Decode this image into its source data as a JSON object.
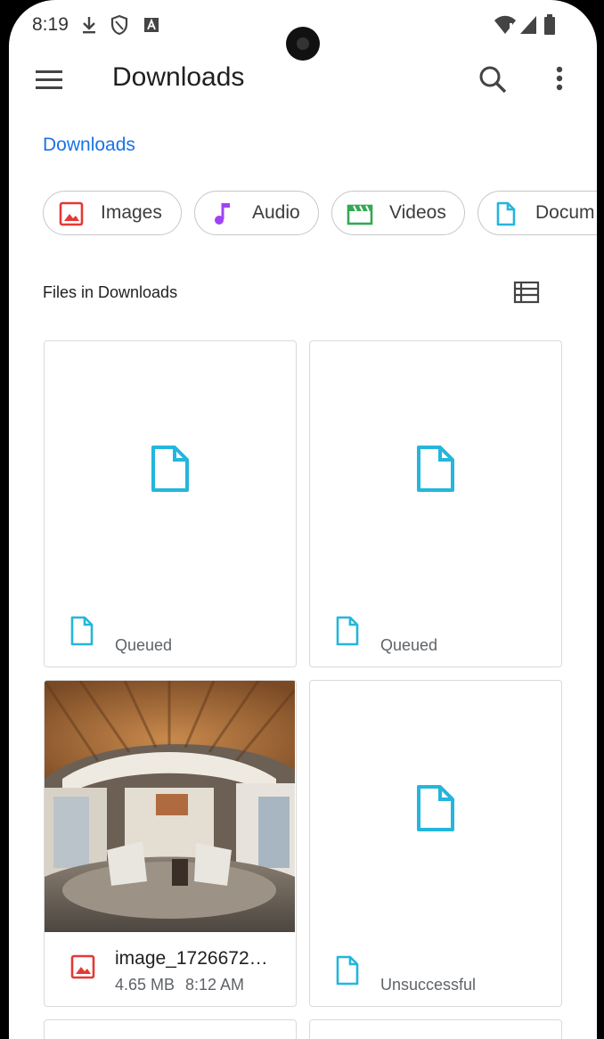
{
  "status_bar": {
    "time": "8:19",
    "icons": [
      "download-icon",
      "shield-icon",
      "keyboard-a-icon",
      "wifi-alert-icon",
      "signal-icon",
      "battery-icon"
    ]
  },
  "app_bar": {
    "title": "Downloads",
    "icons": [
      "menu-icon",
      "search-icon",
      "more-vert-icon"
    ]
  },
  "breadcrumb": {
    "current": "Downloads"
  },
  "filter_chips": [
    {
      "label": "Images",
      "icon": "image-icon",
      "color": "#e53935"
    },
    {
      "label": "Audio",
      "icon": "music-note-icon",
      "color": "#a142f4"
    },
    {
      "label": "Videos",
      "icon": "movie-icon",
      "color": "#34a853"
    },
    {
      "label": "Docum",
      "icon": "document-icon",
      "color": "#24b6dc"
    }
  ],
  "section": {
    "title": "Files in Downloads",
    "view_toggle_icon": "list-view-icon"
  },
  "files": [
    {
      "status": "Queued",
      "icon": "document-icon"
    },
    {
      "status": "Queued",
      "icon": "document-icon"
    },
    {
      "name": "image_1726672…",
      "size": "4.65 MB",
      "time": "8:12 AM",
      "icon": "image-icon",
      "has_thumbnail": true
    },
    {
      "status": "Unsuccessful",
      "icon": "document-icon"
    }
  ],
  "colors": {
    "accent": "#1a73e8",
    "doc_icon": "#24b6dc",
    "image_icon": "#e53935"
  }
}
